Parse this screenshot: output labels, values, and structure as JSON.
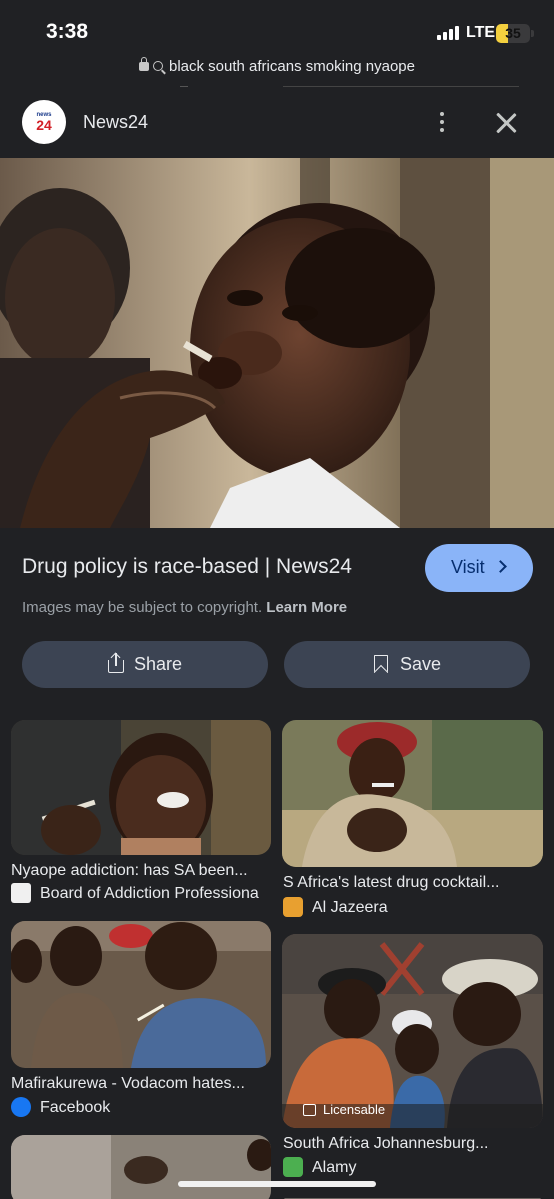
{
  "status_bar": {
    "time": "3:38",
    "network": "LTE",
    "battery": "35",
    "battery_level": 0.35
  },
  "search_bar": {
    "query": "black south africans smoking nyaope"
  },
  "source": {
    "logo_top": "news",
    "logo_num": "24",
    "name": "News24"
  },
  "result": {
    "title": "Drug policy is race-based | News24",
    "visit_label": "Visit",
    "copyright_text": "Images may be subject to copyright.",
    "learn_more": "Learn More",
    "share_label": "Share",
    "save_label": "Save"
  },
  "related": [
    {
      "title": "Nyaope addiction: has SA been...",
      "source": "Board of Addiction Professiona"
    },
    {
      "title": "S Africa's latest drug cocktail...",
      "source": "Al Jazeera"
    },
    {
      "title": "Mafirakurewa - Vodacom hates...",
      "source": "Facebook"
    },
    {
      "title": "South Africa Johannesburg...",
      "source": "Alamy",
      "badge": "Licensable"
    }
  ],
  "colors": {
    "background": "#202124",
    "visit_button": "#8ab4f8",
    "action_button": "#3c4453"
  }
}
